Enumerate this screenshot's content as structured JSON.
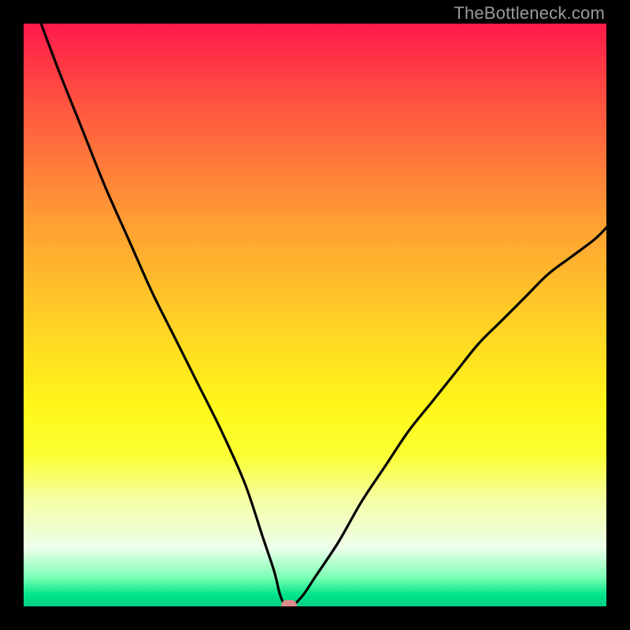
{
  "watermark": "TheBottleneck.com",
  "colors": {
    "frame": "#000000",
    "curve": "#000000",
    "marker": "#dd8b8b",
    "gradient_top": "#ff1a4d",
    "gradient_bottom": "#00d084"
  },
  "chart_data": {
    "type": "line",
    "title": "",
    "xlabel": "",
    "ylabel": "",
    "xlim": [
      0,
      100
    ],
    "ylim": [
      0,
      100
    ],
    "grid": false,
    "legend": false,
    "series": [
      {
        "name": "bottleneck-curve",
        "x": [
          3,
          6,
          10,
          14,
          18,
          22,
          26,
          30,
          34,
          38,
          41,
          43,
          44,
          45,
          46,
          48,
          50,
          54,
          58,
          62,
          66,
          70,
          74,
          78,
          82,
          86,
          90,
          94,
          98,
          100
        ],
        "y": [
          100,
          92,
          82,
          72,
          63,
          54,
          46,
          38,
          30,
          21,
          12,
          6,
          2,
          0,
          0,
          2,
          5,
          11,
          18,
          24,
          30,
          35,
          40,
          45,
          49,
          53,
          57,
          60,
          63,
          65
        ]
      }
    ],
    "annotations": [
      {
        "name": "optimal-marker",
        "x": 45.5,
        "y": 0
      }
    ]
  }
}
